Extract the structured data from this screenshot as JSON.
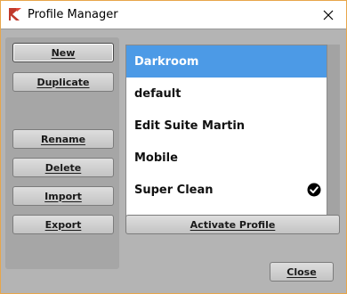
{
  "window": {
    "title": "Profile Manager"
  },
  "buttons": {
    "new": "New",
    "duplicate": "Duplicate",
    "rename": "Rename",
    "delete": "Delete",
    "import": "Import",
    "export": "Export",
    "activate": "Activate Profile",
    "close": "Close"
  },
  "profiles": [
    {
      "name": "Darkroom",
      "selected": true,
      "active": false
    },
    {
      "name": "default",
      "selected": false,
      "active": false
    },
    {
      "name": "Edit Suite Martin",
      "selected": false,
      "active": false
    },
    {
      "name": "Mobile",
      "selected": false,
      "active": false
    },
    {
      "name": "Super Clean",
      "selected": false,
      "active": true
    }
  ],
  "colors": {
    "selection": "#4c9ae6",
    "window_border": "#e8a64a",
    "app_icon": "#c0392b"
  },
  "icons": {
    "app": "cubase-logo-icon",
    "close": "close-icon",
    "active": "checkmark-circle-icon"
  }
}
